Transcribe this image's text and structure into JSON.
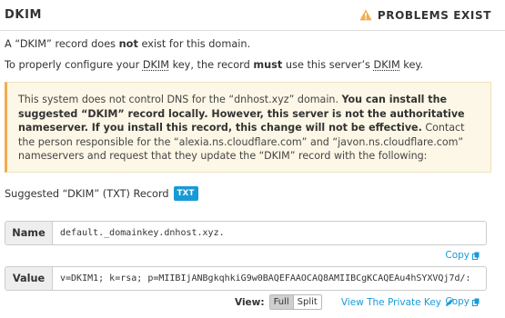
{
  "header": {
    "title": "DKIM",
    "status": "PROBLEMS EXIST"
  },
  "message": {
    "line1": {
      "pre": "A “DKIM” record does ",
      "bold": "not",
      "post": " exist for this domain."
    },
    "line2": {
      "pre": "To properly configure your ",
      "abbr1": "DKIM",
      "mid": " key, the record ",
      "bold": "must",
      "mid2": " use this server’s ",
      "abbr2": "DKIM",
      "post": " key."
    }
  },
  "alert": {
    "pre": "This system does not control DNS for the “dnhost.xyz” domain. ",
    "bold": "You can install the suggested “DKIM” record locally. However, this server is not the authoritative nameserver. If you install this record, this change will not be effective.",
    "post": " Contact the person responsible for the “alexia.ns.cloudflare.com” and “javon.ns.cloudflare.com” nameservers and request that they update the “DKIM” record with the following:"
  },
  "suggested": {
    "label": "Suggested “DKIM” (TXT) Record",
    "badge": "TXT"
  },
  "name_field": {
    "label": "Name",
    "value": "default._domainkey.dnhost.xyz."
  },
  "value_field": {
    "label": "Value",
    "value": "v=DKIM1; k=rsa; p=MIIBIjANBgkqhkiG9w0BAQEFAAOCAQ8AMIIBCgKCAQEAu4hSYXVQj7d/:"
  },
  "copy_label": "Copy",
  "view": {
    "label": "View:",
    "full": "Full",
    "split": "Split",
    "selected": "Full"
  },
  "private_key_label": "View The Private Key",
  "colors": {
    "accent": "#179bd7",
    "warning": "#f0ad4e",
    "alert_bg": "#fcf7e6"
  },
  "icons": {
    "status": "warning-icon",
    "copy": "copy-icon",
    "private_key": "pencil-icon"
  }
}
